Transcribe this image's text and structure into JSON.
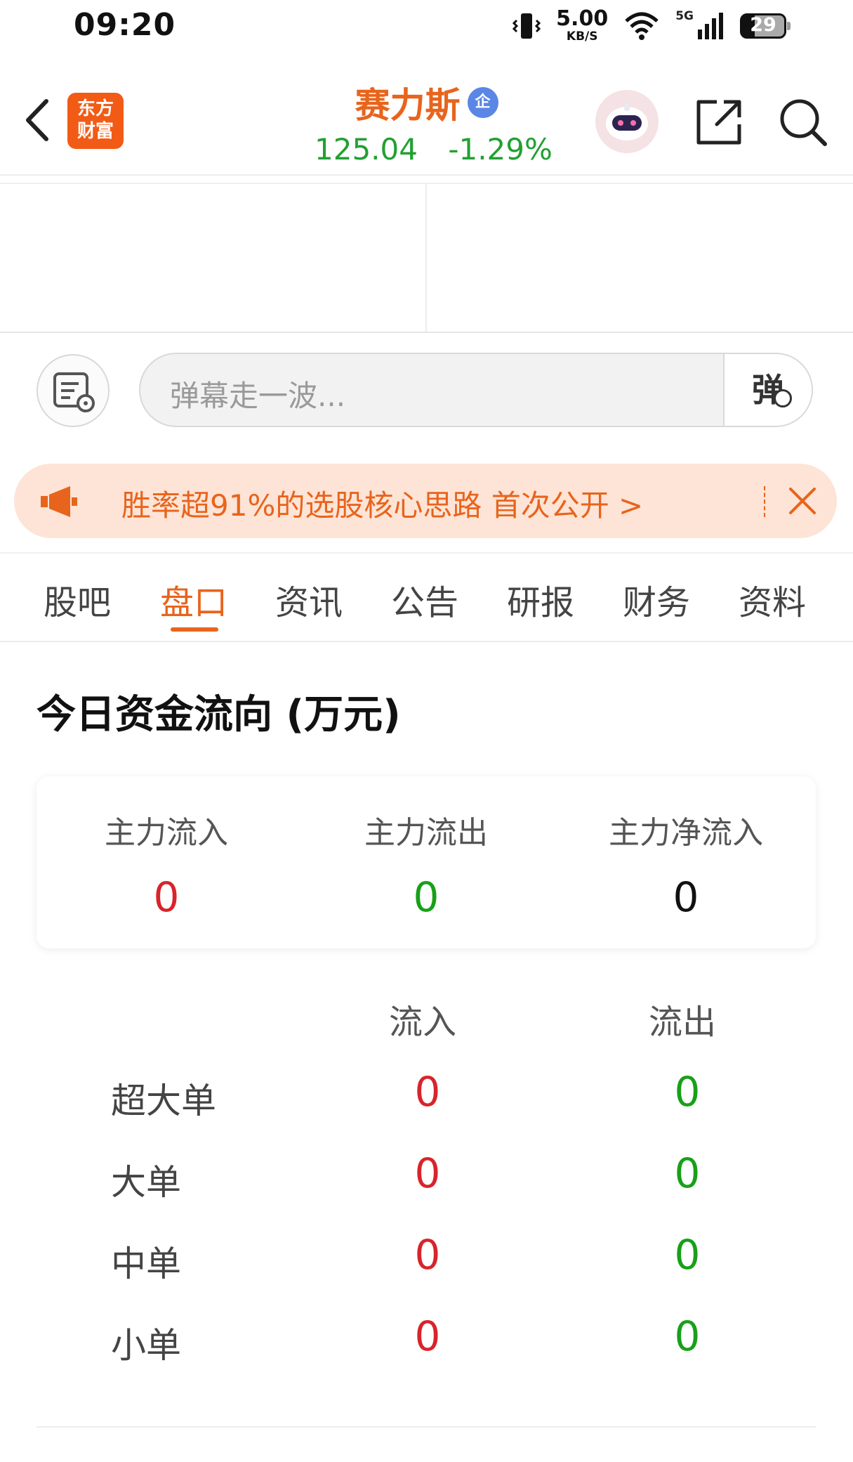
{
  "status_bar": {
    "time": "09:20",
    "net_speed": "5.00",
    "net_unit": "KB/S",
    "network": "5G",
    "battery": "29"
  },
  "header": {
    "logo_text_line1": "东方",
    "logo_text_line2": "财富",
    "stock_name": "赛力斯",
    "badge": "企",
    "price": "125.04",
    "change_pct": "-1.29%"
  },
  "danmu": {
    "placeholder": "弹幕走一波...",
    "send_label": "弹"
  },
  "banner": {
    "text": "胜率超91%的选股核心思路 首次公开 >"
  },
  "tabs": [
    {
      "label": "股吧"
    },
    {
      "label": "盘口"
    },
    {
      "label": "资讯"
    },
    {
      "label": "公告"
    },
    {
      "label": "研报"
    },
    {
      "label": "财务"
    },
    {
      "label": "资料"
    }
  ],
  "fund_flow": {
    "title": "今日资金流向 (万元)",
    "summary": [
      {
        "label": "主力流入",
        "value": "0"
      },
      {
        "label": "主力流出",
        "value": "0"
      },
      {
        "label": "主力净流入",
        "value": "0"
      }
    ],
    "headers": {
      "inflow": "流入",
      "outflow": "流出"
    },
    "rows": [
      {
        "label": "超大单",
        "inflow": "0",
        "outflow": "0"
      },
      {
        "label": "大单",
        "inflow": "0",
        "outflow": "0"
      },
      {
        "label": "中单",
        "inflow": "0",
        "outflow": "0"
      },
      {
        "label": "小单",
        "inflow": "0",
        "outflow": "0"
      }
    ]
  },
  "colors": {
    "accent": "#e8641c",
    "up": "#d8242b",
    "down": "#18a018",
    "price_green": "#22a033"
  }
}
